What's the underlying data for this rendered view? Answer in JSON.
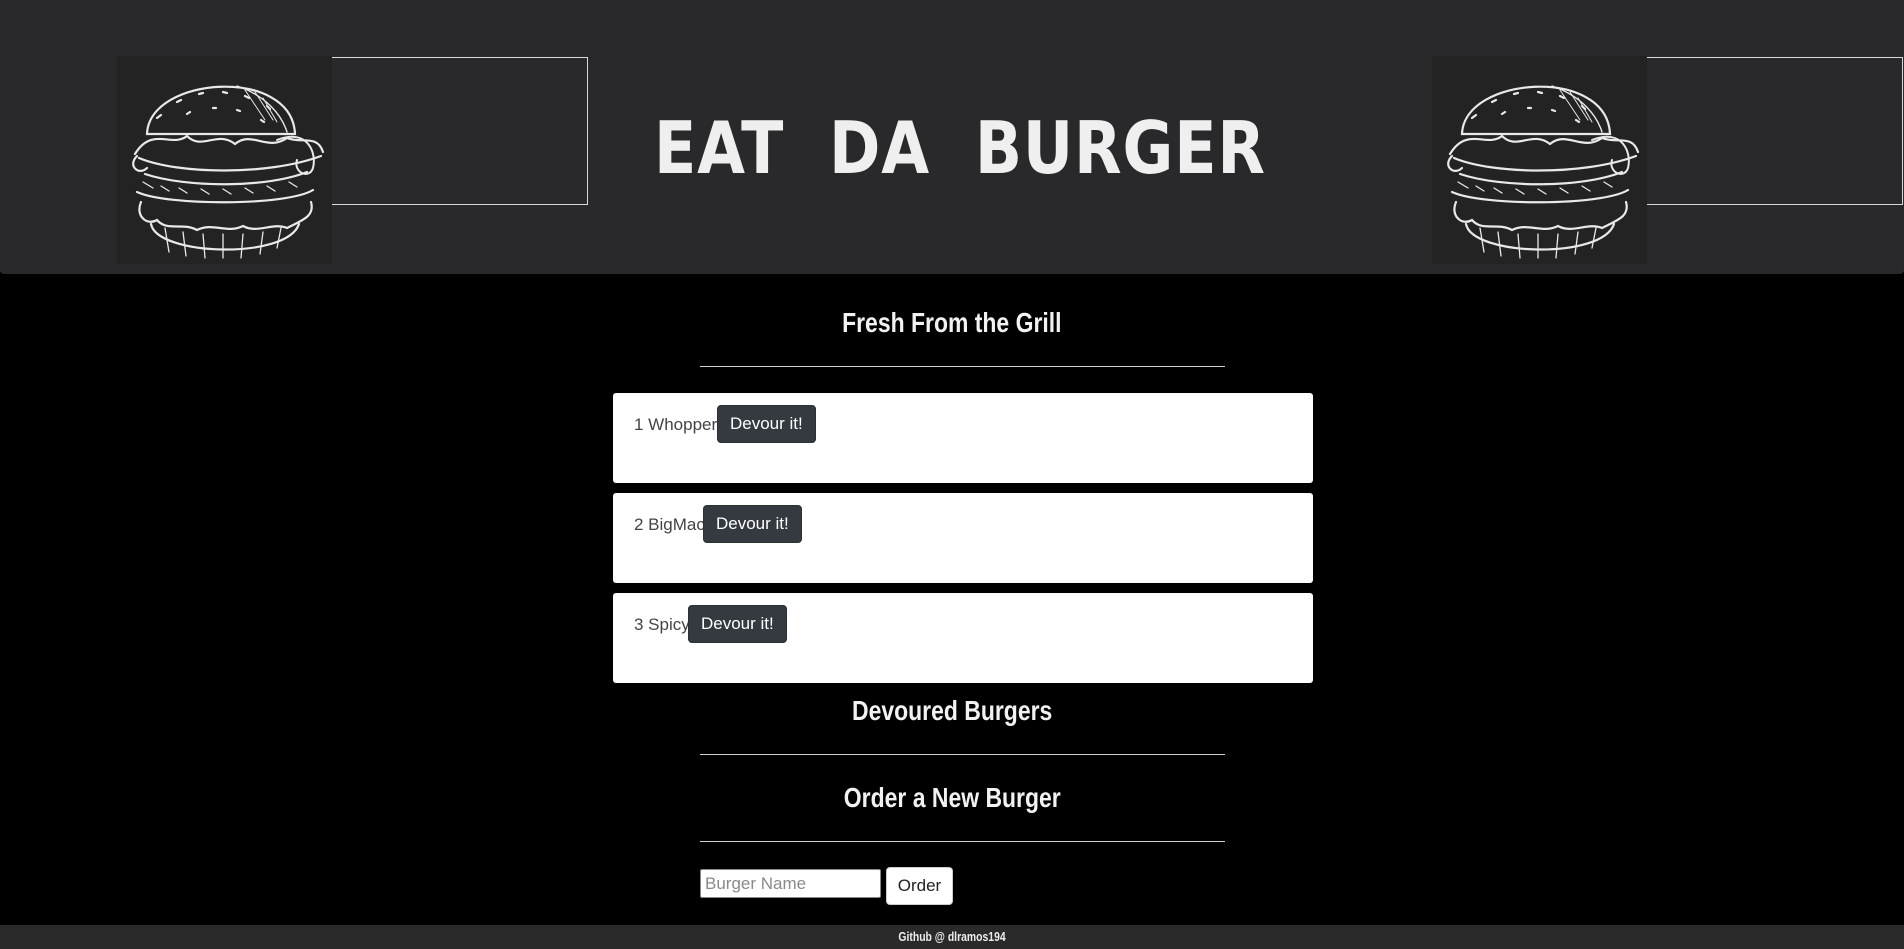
{
  "header": {
    "title": "EAT DA BURGER",
    "logo_icon": "burger-sketch-icon"
  },
  "fresh_section": {
    "heading": "Fresh From the Grill",
    "burgers": [
      {
        "label": "1 Whopper",
        "button_label": "Devour it!"
      },
      {
        "label": "2 BigMac",
        "button_label": "Devour it!"
      },
      {
        "label": "3 Spicy",
        "button_label": "Devour it!"
      }
    ]
  },
  "devoured_section": {
    "heading": "Devoured Burgers"
  },
  "order_section": {
    "heading": "Order a New Burger",
    "input_placeholder": "Burger Name",
    "input_value": "",
    "button_label": "Order"
  },
  "footer": {
    "text": "Github @ dlramos194"
  },
  "colors": {
    "header_bg": "#29282a",
    "page_bg": "#000000",
    "card_bg": "#ffffff",
    "devour_button_bg": "#343a40",
    "footer_bg": "#2a2a2a"
  }
}
